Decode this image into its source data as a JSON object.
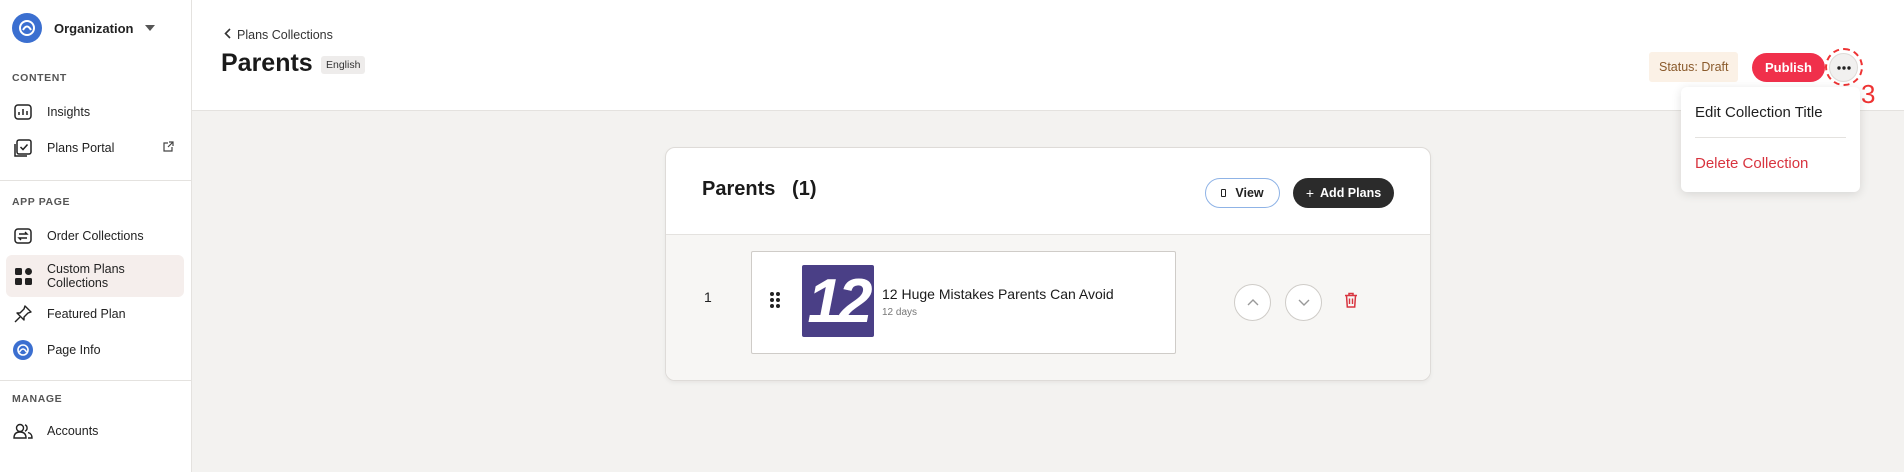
{
  "sidebar": {
    "org_name": "Organization",
    "sections": {
      "content": "CONTENT",
      "app_page": "APP PAGE",
      "manage": "MANAGE"
    },
    "items": {
      "insights": "Insights",
      "plans_portal": "Plans Portal",
      "order_collections": "Order Collections",
      "custom_plans_collections": "Custom Plans Collections",
      "featured_plan": "Featured Plan",
      "page_info": "Page Info",
      "accounts": "Accounts"
    }
  },
  "header": {
    "back_label": "Plans Collections",
    "title": "Parents",
    "language": "English",
    "status": "Status: Draft",
    "publish_label": "Publish"
  },
  "annotation": {
    "number": "3",
    "color": "#e33333"
  },
  "menu": {
    "edit_label": "Edit Collection Title",
    "delete_label": "Delete Collection"
  },
  "collection": {
    "title": "Parents   (1)",
    "view_label": "View",
    "add_label": "Add Plans",
    "plans": [
      {
        "index": "1",
        "thumb_text": "12",
        "title": "12 Huge Mistakes Parents Can Avoid",
        "duration": "12 days"
      }
    ]
  },
  "colors": {
    "accent": "#f0304b",
    "danger": "#d8343f",
    "thumb_bg": "#4a3f86",
    "sidebar_active": "#f5eeec"
  }
}
